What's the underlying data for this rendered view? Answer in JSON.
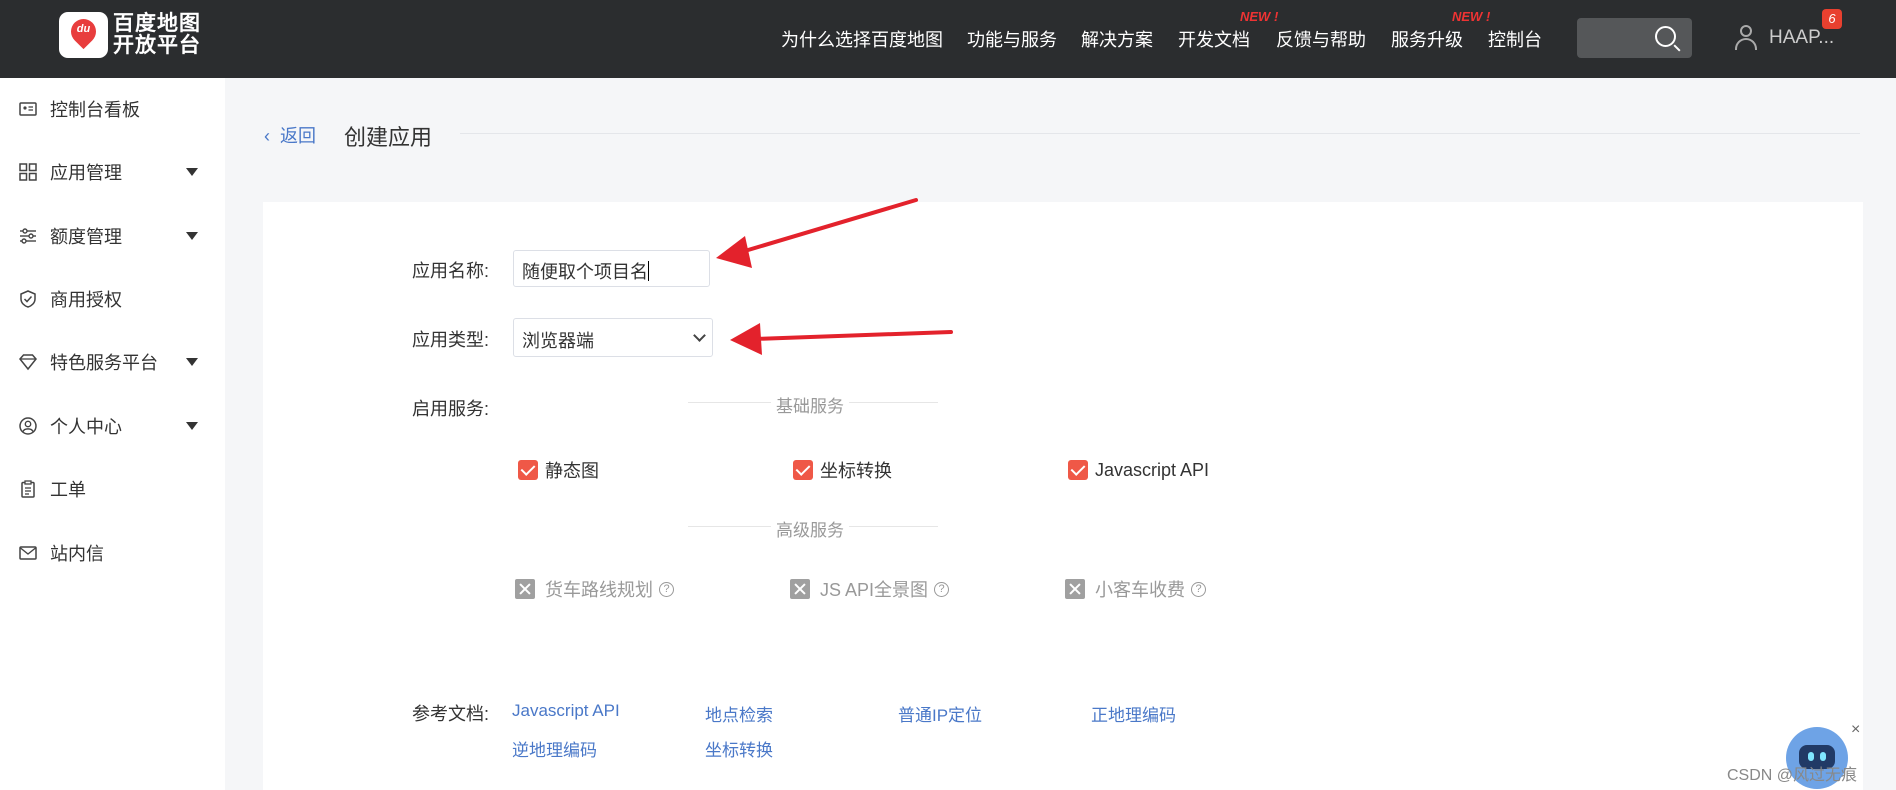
{
  "topbar": {
    "logo_line1": "百度地图",
    "logo_line2": "开放平台",
    "logo_mark": "du",
    "nav": [
      {
        "label": "为什么选择百度地图",
        "badge": ""
      },
      {
        "label": "功能与服务",
        "badge": ""
      },
      {
        "label": "解决方案",
        "badge": ""
      },
      {
        "label": "开发文档",
        "badge": "NEW !"
      },
      {
        "label": "反馈与帮助",
        "badge": ""
      },
      {
        "label": "服务升级",
        "badge": "NEW !"
      },
      {
        "label": "控制台",
        "badge": ""
      }
    ],
    "user_name": "HAAP...",
    "notification_count": "6"
  },
  "sidebar": {
    "items": [
      {
        "label": "控制台看板",
        "icon": "dashboard-card-icon",
        "expandable": false
      },
      {
        "label": "应用管理",
        "icon": "grid-icon",
        "expandable": true
      },
      {
        "label": "额度管理",
        "icon": "sliders-icon",
        "expandable": true
      },
      {
        "label": "商用授权",
        "icon": "shield-check-icon",
        "expandable": false
      },
      {
        "label": "特色服务平台",
        "icon": "diamond-icon",
        "expandable": true
      },
      {
        "label": "个人中心",
        "icon": "user-circle-icon",
        "expandable": true
      },
      {
        "label": "工单",
        "icon": "clipboard-icon",
        "expandable": false
      },
      {
        "label": "站内信",
        "icon": "mail-icon",
        "expandable": false
      }
    ]
  },
  "header": {
    "back_label": "返回",
    "title": "创建应用"
  },
  "form": {
    "app_name_label": "应用名称:",
    "app_name_value": "随便取个项目名",
    "app_type_label": "应用类型:",
    "app_type_value": "浏览器端",
    "services_label": "启用服务:",
    "basic_section": "基础服务",
    "basic_services": [
      {
        "label": "静态图",
        "checked": true
      },
      {
        "label": "坐标转换",
        "checked": true
      },
      {
        "label": "Javascript API",
        "checked": true
      }
    ],
    "advanced_section": "高级服务",
    "advanced_services": [
      {
        "label": "货车路线规划",
        "enabled": false
      },
      {
        "label": "JS API全景图",
        "enabled": false
      },
      {
        "label": "小客车收费",
        "enabled": false
      }
    ],
    "docs_label": "参考文档:",
    "docs": [
      "Javascript API",
      "地点检索",
      "普通IP定位",
      "正地理编码",
      "逆地理编码",
      "坐标转换"
    ]
  },
  "annotations": {
    "arrow_color": "#e3222c"
  },
  "footer": {
    "close_glyph": "×",
    "watermark": "CSDN @风过无痕"
  }
}
